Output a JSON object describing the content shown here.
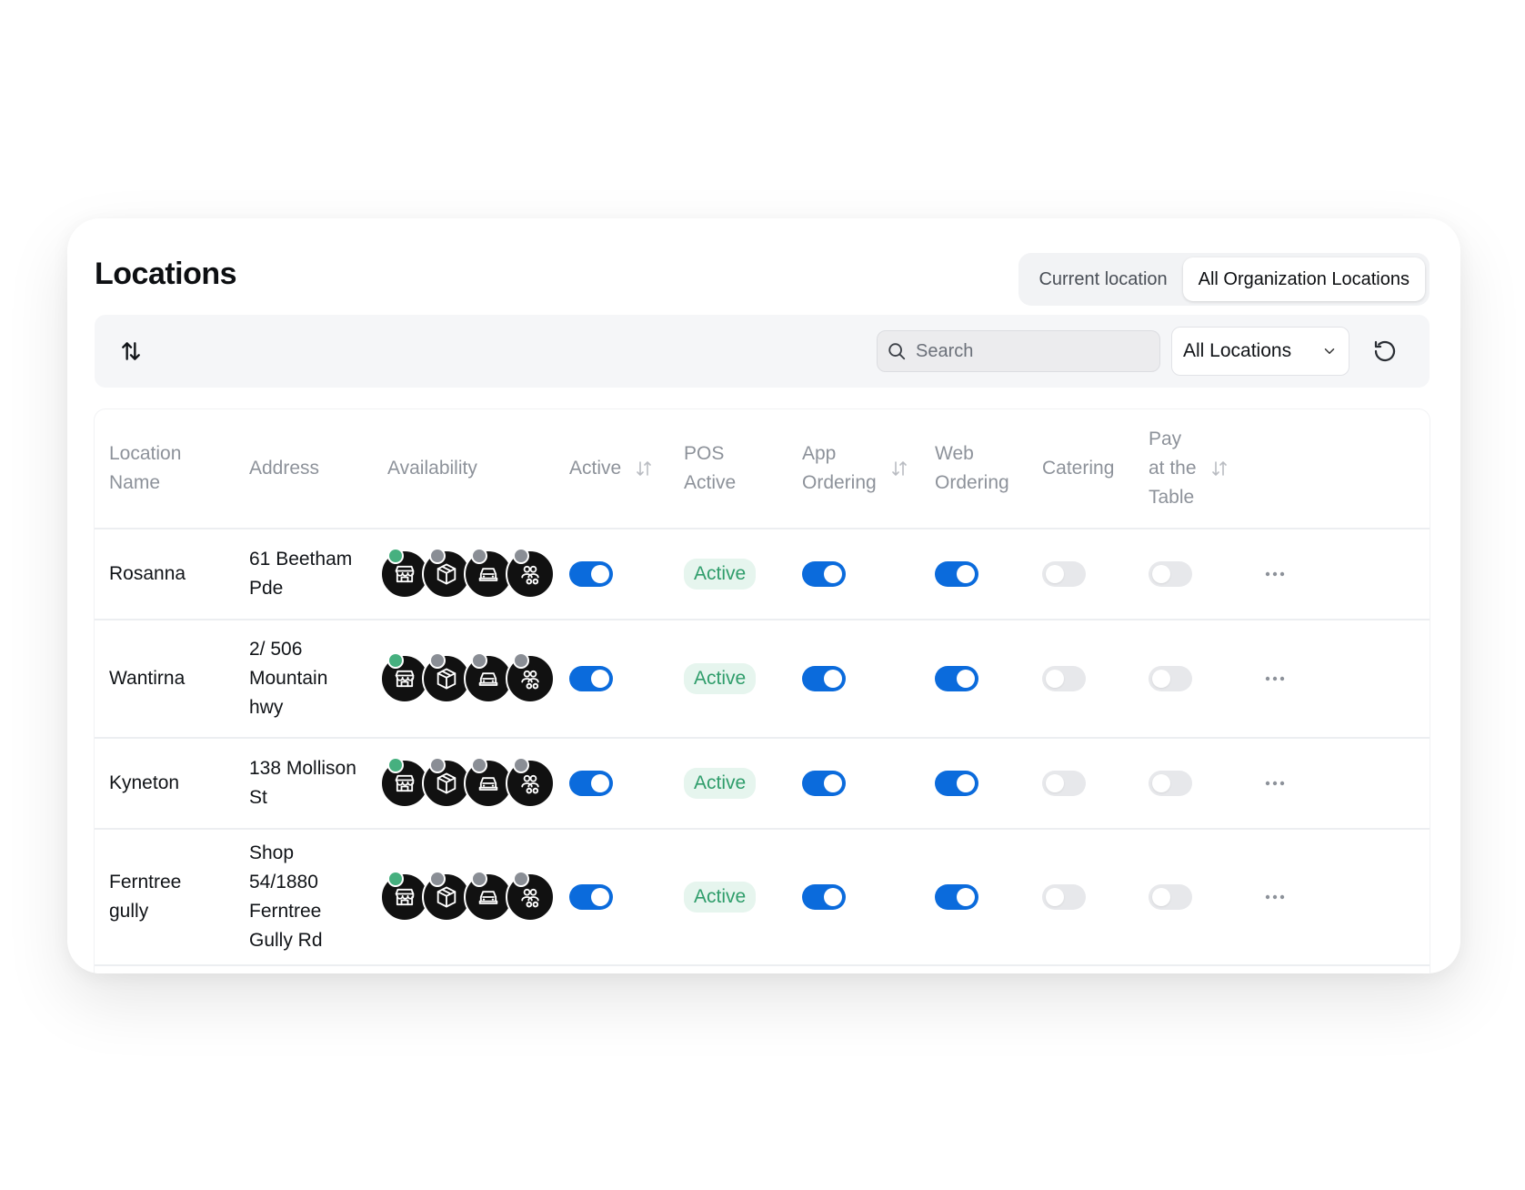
{
  "page": {
    "title": "Locations"
  },
  "scope_tabs": [
    {
      "label": "Current location",
      "active": false
    },
    {
      "label": "All Organization Locations",
      "active": true
    }
  ],
  "toolbar": {
    "sort_icon": "sort-arrows-icon",
    "search_placeholder": "Search",
    "search_value": "",
    "filter_selected": "All Locations",
    "refresh_icon": "refresh-icon"
  },
  "columns": [
    {
      "label": "Location\nName",
      "sortable": false
    },
    {
      "label": "Address",
      "sortable": false
    },
    {
      "label": "Availability",
      "sortable": false
    },
    {
      "label": "Active",
      "sortable": true
    },
    {
      "label": "POS\nActive",
      "sortable": false
    },
    {
      "label": "App\nOrdering",
      "sortable": true
    },
    {
      "label": "Web\nOrdering",
      "sortable": false
    },
    {
      "label": "Catering",
      "sortable": false
    },
    {
      "label": "Pay\nat the\nTable",
      "sortable": true
    }
  ],
  "availability_icons": [
    "storefront-icon",
    "box-icon",
    "car-icon",
    "group-icon"
  ],
  "colors": {
    "toggle_on": "#0b6bdc",
    "toggle_off": "#e7e8eb",
    "badge_bg": "#e6f5ee",
    "badge_text": "#2f9d6b",
    "dot_on": "#46b07f",
    "dot_off": "#8a8e95"
  },
  "rows": [
    {
      "name": "Rosanna",
      "address": "61 Beetham\nPde",
      "availability_dots": [
        true,
        false,
        false,
        false
      ],
      "active": true,
      "pos_status": "Active",
      "app_ordering": true,
      "web_ordering": true,
      "catering": false,
      "pay_at_table": false
    },
    {
      "name": "Wantirna",
      "address": "2/ 506\nMountain\nhwy",
      "availability_dots": [
        true,
        false,
        false,
        false
      ],
      "active": true,
      "pos_status": "Active",
      "app_ordering": true,
      "web_ordering": true,
      "catering": false,
      "pay_at_table": false
    },
    {
      "name": "Kyneton",
      "address": "138 Mollison\nSt",
      "availability_dots": [
        true,
        false,
        false,
        false
      ],
      "active": true,
      "pos_status": "Active",
      "app_ordering": true,
      "web_ordering": true,
      "catering": false,
      "pay_at_table": false
    },
    {
      "name": "Ferntree\ngully",
      "address": "Shop\n54/1880\nFerntree\nGully Rd",
      "availability_dots": [
        true,
        false,
        false,
        false
      ],
      "active": true,
      "pos_status": "Active",
      "app_ordering": true,
      "web_ordering": true,
      "catering": false,
      "pay_at_table": false
    }
  ]
}
